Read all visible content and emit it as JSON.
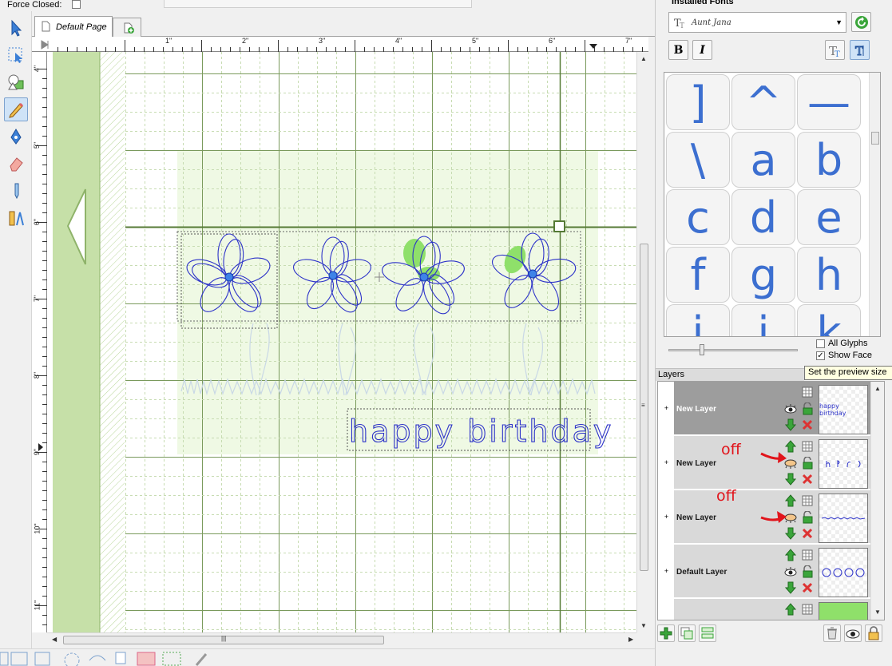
{
  "top": {
    "force_closed_label": "Force Closed:"
  },
  "tabs": {
    "page_tab_label": "Default Page"
  },
  "rulers": {
    "horizontal": [
      "1\"",
      "2\"",
      "3\"",
      "4\"",
      "5\"",
      "6\"",
      "7\""
    ],
    "vertical": [
      "4\"",
      "5\"",
      "6\"",
      "7\"",
      "8\"",
      "9\"",
      "10\"",
      "11\""
    ]
  },
  "canvas": {
    "text_element": "happy birthday",
    "colors": {
      "page_green": "#c6e0a8",
      "work_area": "#eff9e4",
      "grid_line": "#7a9a5c",
      "stroke_blue": "#2d33c9"
    }
  },
  "fonts_panel": {
    "title": "Installed Fonts",
    "font_value": "Aunt Jana",
    "bold_label": "B",
    "italic_label": "I",
    "glyphs": [
      "]",
      "^",
      "—",
      "\\",
      "a",
      "b",
      "c",
      "d",
      "e",
      "f",
      "g",
      "h",
      "i",
      "j",
      "k"
    ],
    "all_glyphs_label": "All Glyphs",
    "all_glyphs_checked": false,
    "show_face_label": "Show Face",
    "show_face_checked": true,
    "tooltip": "Set the preview size"
  },
  "layers_panel": {
    "title": "Layers",
    "layers": [
      {
        "name": "New Layer",
        "selected": true,
        "visible": true,
        "thumb_text": "happy birthday"
      },
      {
        "name": "New Layer",
        "selected": false,
        "visible": false,
        "annotation": "off"
      },
      {
        "name": "New Layer",
        "selected": false,
        "visible": false,
        "annotation": "off"
      },
      {
        "name": "Default Layer",
        "selected": false,
        "visible": true
      }
    ]
  }
}
